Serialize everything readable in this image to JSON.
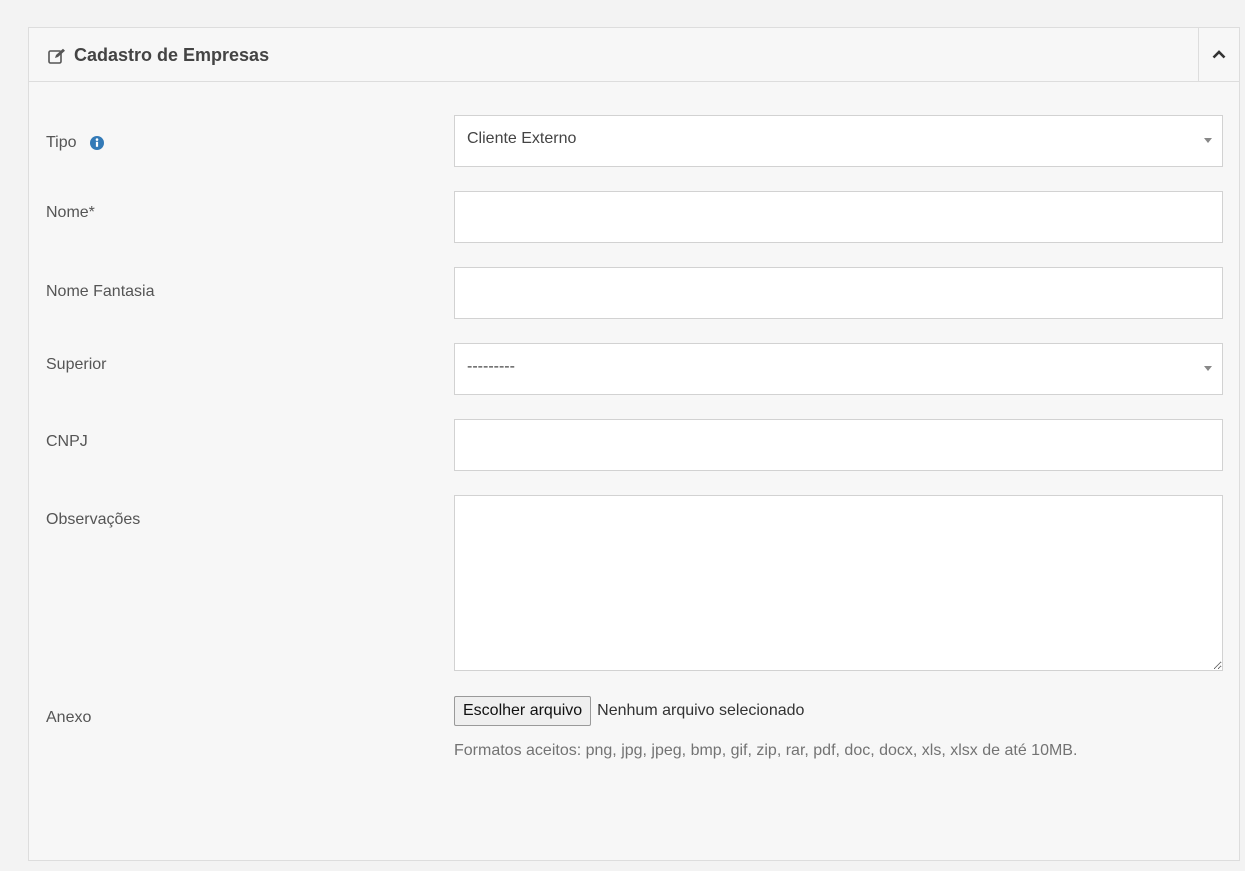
{
  "panel": {
    "title": "Cadastro de Empresas",
    "title_icon": "edit-icon",
    "collapse_icon": "chevron-up-icon"
  },
  "form": {
    "tipo": {
      "label": "Tipo",
      "value": "Cliente Externo",
      "info_icon": "info-icon"
    },
    "nome": {
      "label": "Nome*",
      "value": ""
    },
    "nome_fantasia": {
      "label": "Nome Fantasia",
      "value": ""
    },
    "superior": {
      "label": "Superior",
      "value": "---------"
    },
    "cnpj": {
      "label": "CNPJ",
      "value": ""
    },
    "observacoes": {
      "label": "Observações",
      "value": ""
    },
    "anexo": {
      "label": "Anexo",
      "button_label": "Escolher arquivo",
      "status": "Nenhum arquivo selecionado",
      "help": "Formatos aceitos: png, jpg, jpeg, bmp, gif, zip, rar, pdf, doc, docx, xls, xlsx de até 10MB."
    }
  },
  "colors": {
    "info_icon": "#337ab7",
    "border": "#d2d2d2",
    "panel_bg": "#f7f7f7"
  }
}
